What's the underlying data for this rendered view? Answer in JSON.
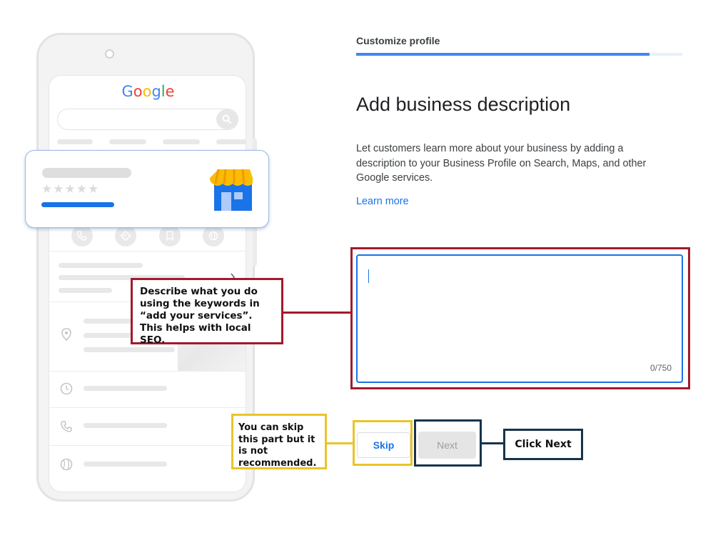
{
  "phone": {
    "logo_letters": [
      {
        "char": "G",
        "color": "#4285F4"
      },
      {
        "char": "o",
        "color": "#EA4335"
      },
      {
        "char": "o",
        "color": "#FBBC05"
      },
      {
        "char": "g",
        "color": "#4285F4"
      },
      {
        "char": "l",
        "color": "#34A853"
      },
      {
        "char": "e",
        "color": "#EA4335"
      }
    ],
    "search_icon": "search-icon",
    "action_icons": [
      "phone-icon",
      "directions-icon",
      "bookmark-icon",
      "globe-icon"
    ],
    "row_icons": [
      "location-pin-icon",
      "clock-icon",
      "phone-icon",
      "globe-icon"
    ],
    "card": {
      "stars": "★★★★★",
      "store_icon": "storefront-icon"
    }
  },
  "form": {
    "step_label": "Customize profile",
    "progress_percent": 90,
    "heading": "Add business description",
    "description": "Let customers learn more about your business by adding a description to your Business Profile on Search, Maps, and other Google services.",
    "learn_more": "Learn more",
    "textarea": {
      "value": "",
      "char_count": "0/750"
    },
    "skip_label": "Skip",
    "next_label": "Next"
  },
  "callouts": {
    "seo": "Describe what you do using the keywords in “add your services”. This helps with local SEO.",
    "skip": "You can skip this part but it is not recommended.",
    "next": "Click Next"
  },
  "colors": {
    "accent_blue": "#1a73e8",
    "callout_red": "#a11a2c",
    "callout_yellow": "#e8c52a",
    "callout_navy": "#17334a",
    "progress_fill": "#4285f4"
  }
}
